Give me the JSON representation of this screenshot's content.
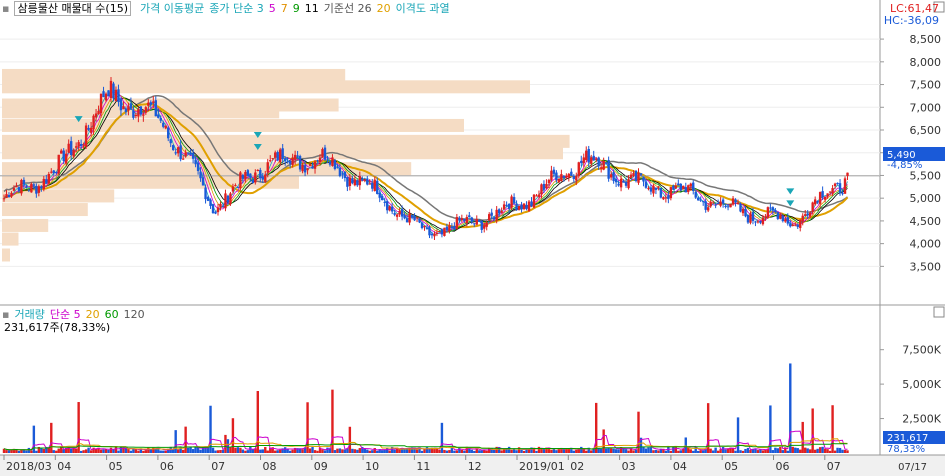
{
  "price_panel": {
    "stock_name": "삼릉물산 매물대 수(15)",
    "legend": [
      {
        "text": "가격 이동평균",
        "color": "#1aa6b7"
      },
      {
        "text": "종가 단순 3",
        "color": "#1aa6b7"
      },
      {
        "text": "5",
        "color": "#cc00cc"
      },
      {
        "text": "7",
        "color": "#e09000"
      },
      {
        "text": "9",
        "color": "#009900"
      },
      {
        "text": "11",
        "color": "#000000"
      },
      {
        "text": "기준선 26",
        "color": "#555555"
      },
      {
        "text": "20",
        "color": "#e0a000"
      },
      {
        "text": "이격도 과열",
        "color": "#1aa6b7"
      }
    ],
    "lc_label": "LC:61,47",
    "hc_label": "HC:-36,09",
    "current_price": "5,490",
    "change_pct": "-4,85%",
    "y_ticks": [
      "8,500",
      "8,000",
      "7,500",
      "7,000",
      "6,500",
      "6,000",
      "5,500",
      "5,000",
      "4,500",
      "4,000",
      "3,500"
    ]
  },
  "volume_panel": {
    "title_legend": [
      {
        "text": "거래량",
        "color": "#1aa6b7"
      },
      {
        "text": "단순 5",
        "color": "#cc00cc"
      },
      {
        "text": "20",
        "color": "#e0a000"
      },
      {
        "text": "60",
        "color": "#009900"
      },
      {
        "text": "120",
        "color": "#555555"
      }
    ],
    "volume_info": "231,617주(78,33%)",
    "y_ticks": [
      "7,500K",
      "5,000K",
      "2,500K"
    ],
    "current_volume": "231,617",
    "current_volume_pct": "78,33%"
  },
  "x_axis": {
    "labels": [
      "2018/03",
      "04",
      "05",
      "06",
      "07",
      "08",
      "09",
      "10",
      "11",
      "12",
      "2019/01",
      "02",
      "03",
      "04",
      "05",
      "06",
      "07"
    ],
    "end_date": "07/17"
  },
  "colors": {
    "up": "#e02020",
    "down": "#1a5ad8",
    "volume_profile": "#f5dcc4",
    "price_box": "#1a5ad8",
    "volume_box": "#1a5ad8",
    "grid": "#cccccc",
    "axis_bg": "#f0f0f0"
  },
  "chart_data": {
    "type": "candlestick",
    "price_y_range": [
      3200,
      8700
    ],
    "volume_y_range": [
      0,
      9800
    ],
    "x_month_labels": [
      "2018/03",
      "04",
      "05",
      "06",
      "07",
      "08",
      "09",
      "10",
      "11",
      "12",
      "2019/01",
      "02",
      "03",
      "04",
      "05",
      "06",
      "07"
    ],
    "close_series_monthly_approx": [
      5000,
      5600,
      7300,
      6700,
      4800,
      5800,
      5900,
      5200,
      4200,
      4500,
      5000,
      5900,
      5300,
      5100,
      4700,
      4500,
      5490
    ],
    "volume_profile_levels": [
      {
        "price": 7700,
        "strength": 0.52
      },
      {
        "price": 7450,
        "strength": 0.8
      },
      {
        "price": 7050,
        "strength": 0.51
      },
      {
        "price": 6900,
        "strength": 0.42
      },
      {
        "price": 6600,
        "strength": 0.7
      },
      {
        "price": 6250,
        "strength": 0.86
      },
      {
        "price": 6000,
        "strength": 0.85
      },
      {
        "price": 5650,
        "strength": 0.62
      },
      {
        "price": 5350,
        "strength": 0.45
      },
      {
        "price": 5050,
        "strength": 0.17
      },
      {
        "price": 4750,
        "strength": 0.13
      },
      {
        "price": 4400,
        "strength": 0.07
      },
      {
        "price": 4100,
        "strength": 0.025
      },
      {
        "price": 3750,
        "strength": 0.012
      }
    ]
  }
}
